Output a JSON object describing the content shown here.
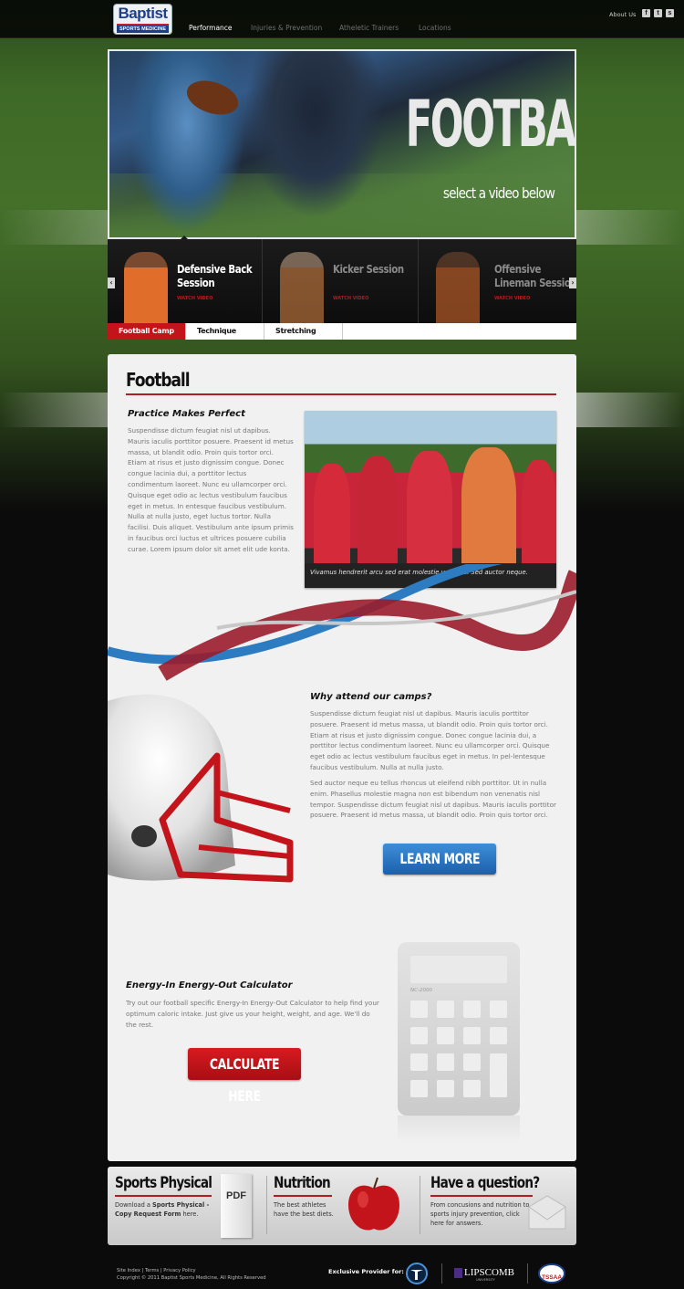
{
  "header": {
    "logo_line1": "Baptist",
    "logo_line2": "SPORTS MEDICINE",
    "nav": [
      "Performance",
      "Injuries & Prevention",
      "Atheletic Trainers",
      "Locations"
    ],
    "about": "About Us",
    "social": [
      "f",
      "t",
      "s"
    ]
  },
  "hero": {
    "title": "FOOTBALL",
    "subtitle": "select a video below"
  },
  "carousel": {
    "slides": [
      {
        "title": "Defensive Back Session",
        "watch": "WATCH VIDEO"
      },
      {
        "title": "Kicker Session",
        "watch": "WATCH VIDEO"
      },
      {
        "title": "Offensive Lineman Session",
        "watch": "WATCH VIDEO"
      }
    ],
    "prev": "‹",
    "next": "›"
  },
  "tabs": [
    "Football Camp",
    "Technique",
    "Stretching"
  ],
  "main": {
    "title": "Football",
    "s1_heading": "Practice Makes Perfect",
    "s1_body": "Suspendisse dictum feugiat nisl ut dapibus. Mauris iaculis porttitor posuere. Praesent id metus massa, ut blandit odio. Proin quis tortor orci. Etiam at risus et justo dignissim congue. Donec congue lacinia dui, a porttitor lectus condimentum laoreet. Nunc eu ullamcorper orci. Quisque eget odio ac lectus vestibulum faucibus eget in metus. In entesque faucibus vestibulum. Nulla at nulla justo, eget luctus tortor. Nulla facilisi. Duis aliquet. Vestibulum ante ipsum primis in faucibus orci luctus et ultrices posuere cubilia curae. Lorem ipsum dolor sit amet elit ude konta.",
    "photo_caption": "Vivamus hendrerit arcu sed erat molestie vehicula. Sed auctor neque.",
    "s2_heading": "Why attend our camps?",
    "s2_body1": "Suspendisse dictum feugiat nisl ut dapibus. Mauris iaculis porttitor posuere. Praesent id metus massa, ut blandit odio. Proin quis tortor orci. Etiam at risus et justo dignissim congue. Donec congue lacinia dui, a porttitor lectus condimentum laoreet. Nunc eu ullamcorper orci. Quisque eget odio ac lectus vestibulum faucibus eget in metus. In pel-lentesque faucibus vestibulum. Nulla at nulla justo.",
    "s2_body2": "Sed auctor neque eu tellus rhoncus ut eleifend nibh porttitor. Ut in nulla enim. Phasellus molestie magna non est bibendum non venenatis nisl tempor. Suspendisse dictum feugiat nisl ut dapibus. Mauris iaculis porttitor posuere. Praesent id metus massa, ut blandit odio. Proin quis tortor orci.",
    "learn_more": "LEARN MORE",
    "s3_heading": "Energy-In Energy-Out Calculator",
    "s3_body": "Try out our football specific Energy-In Energy-Out Calculator to help find your optimum caloric intake. Just give us your height, weight, and age. We'll do the rest.",
    "calculate": "CALCULATE HERE",
    "calc_model": "NC-2000"
  },
  "promo": {
    "p1_title": "Sports Physical",
    "p1_body_a": "Download a ",
    "p1_body_b": "Sports Physical - Copy Request Form",
    "p1_body_c": " here.",
    "pdf_label": "PDF",
    "p2_title": "Nutrition",
    "p2_body": "The best athletes have the best diets.",
    "p3_title": "Have a question?",
    "p3_body": "From concusions and nutrition to sports injury prevention, click here for answers."
  },
  "footer": {
    "links": [
      "Site Index",
      "Terms",
      "Privacy Policy"
    ],
    "copyright": "Copyright © 2011 Baptist Sports Medicine, All Rights Reserved",
    "exclusive": "Exclusive Provider for:",
    "partner_lipscomb": "LIPSCOMB",
    "partner_lipscomb_sub": "UNIVERSITY",
    "partner_tssaa": "TSSAA"
  },
  "colors": {
    "brand_red": "#c4141b",
    "brand_blue": "#1d3f86",
    "button_blue": "#2b74c4"
  }
}
